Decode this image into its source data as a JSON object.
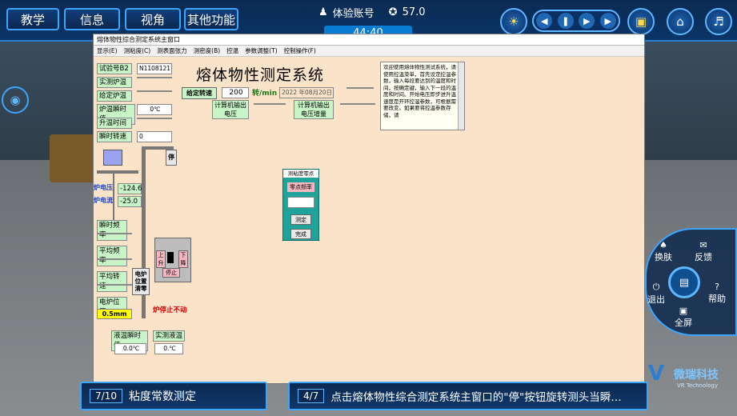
{
  "header": {
    "tabs": [
      "教学",
      "信息",
      "视角",
      "其他功能"
    ],
    "account_label": "体验账号",
    "score": "57.0",
    "timer": "44:40"
  },
  "window": {
    "title": "熔体物性综合测定系统主窗口",
    "menu": [
      "显示(E)",
      "测粘度(C)",
      "测表面张力",
      "测密度(B)",
      "控温",
      "参数调整(T)",
      "控制操作(F)"
    ],
    "big_title": "熔体物性测定系统",
    "left_labels": [
      "试验号B2",
      "实测炉温",
      "给定炉温",
      "炉温瞬时值",
      "升温时间",
      "瞬时转速"
    ],
    "left_values": [
      "N1108121",
      "",
      "",
      "0℃",
      "",
      "0"
    ],
    "set_speed_label": "给定转速",
    "speed_value": "200",
    "speed_unit": "转/min",
    "date": "2022 年08月20日",
    "out_voltage_label": "计算机输出电压",
    "out_increment_label": "计算机输出电压增量",
    "stop_button": "停",
    "furnace_voltage_label": "炉电压",
    "furnace_voltage": "-124.6",
    "furnace_current_label": "炉电流",
    "furnace_current": "-25.0",
    "instant_freq_label": "瞬时频率",
    "avg_freq_label": "平均频率",
    "avg_speed_label": "平均转速",
    "furnace_pos_label": "电炉位置",
    "furnace_pos_value": "0.5mm",
    "pos_reset_label": "电炉位置清零",
    "up_label": "上升",
    "down_label": "下降",
    "stop_label": "停止",
    "furnace_status": "炉停止不动",
    "liquid_temp_label": "液温瞬时值",
    "liquid_temp_value": "0.0℃",
    "actual_liquid_label": "实测液温",
    "actual_liquid_value": "0.℃",
    "info_text": "欢迎使用熔体物性测试系统，请使用控温菜单，首先设定控温参数，输入每段要达到的温度和时间，按确定键，输入下一段的温度和时间。开始电压即步进升温速度是开环控温参数，可根据需要改变。如果要将控温参数存储，请",
    "dialog": {
      "title": "测粘度零点",
      "field_label": "零点频率",
      "measure_button": "测定",
      "done_button": "完成"
    }
  },
  "right_panel": {
    "skin": "换肤",
    "feedback": "反馈",
    "exit": "退出",
    "help": "帮助",
    "fullscreen": "全屏"
  },
  "footer": {
    "left_num": "7/10",
    "left_text": "粘度常数测定",
    "right_num": "4/7",
    "right_text": "点击熔体物性综合测定系统主窗口的\"停\"按钮旋转测头当瞬…"
  },
  "logo": {
    "name": "微瑞科技",
    "sub": "VR Technology"
  }
}
